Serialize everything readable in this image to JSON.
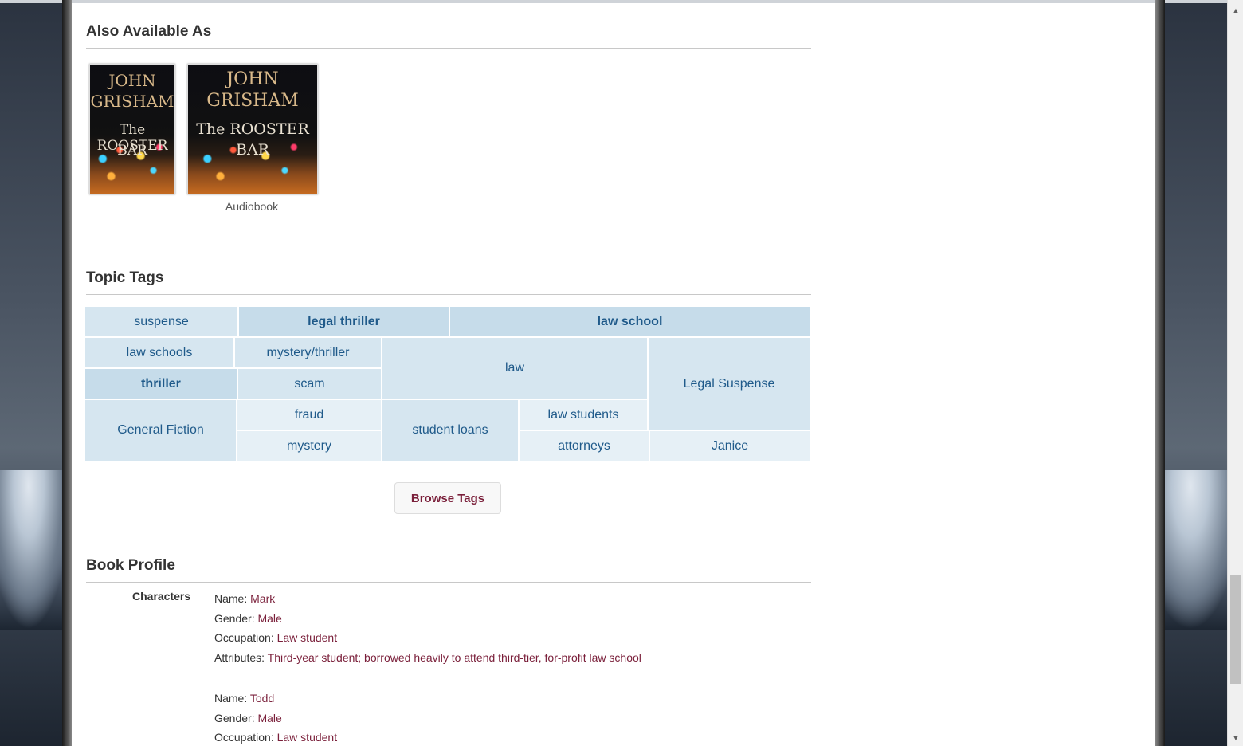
{
  "also_available": {
    "title": "Also Available As",
    "covers": [
      {
        "author_line1": "JOHN",
        "author_line2": "GRISHAM",
        "title_line1": "The ROOSTER",
        "title_line2": "BAR",
        "label": ""
      },
      {
        "author_line1": "JOHN",
        "author_line2": "GRISHAM",
        "title_line1": "The ROOSTER",
        "title_line2": "BAR",
        "label": "Audiobook"
      }
    ]
  },
  "topic_tags": {
    "title": "Topic Tags",
    "tags": {
      "suspense": "suspense",
      "legal_thriller": "legal thriller",
      "law_school": "law school",
      "law_schools": "law schools",
      "mystery_thriller": "mystery/thriller",
      "law": "law",
      "legal_suspense": "Legal Suspense",
      "thriller": "thriller",
      "scam": "scam",
      "general_fiction": "General Fiction",
      "fraud": "fraud",
      "student_loans": "student loans",
      "law_students": "law students",
      "mystery": "mystery",
      "attorneys": "attorneys",
      "janice": "Janice"
    },
    "browse_label": "Browse Tags"
  },
  "book_profile": {
    "title": "Book Profile",
    "characters_label": "Characters",
    "characters": [
      {
        "name_label": "Name:",
        "name": "Mark",
        "gender_label": "Gender:",
        "gender": "Male",
        "occupation_label": "Occupation:",
        "occupation": "Law student",
        "attributes_label": "Attributes:",
        "attributes": "Third-year student; borrowed heavily to attend third-tier, for-profit law school"
      },
      {
        "name_label": "Name:",
        "name": "Todd",
        "gender_label": "Gender:",
        "gender": "Male",
        "occupation_label": "Occupation:",
        "occupation": "Law student"
      }
    ]
  },
  "colors": {
    "tag_text": "#1f5a8a",
    "value_text": "#7a1f3a"
  }
}
